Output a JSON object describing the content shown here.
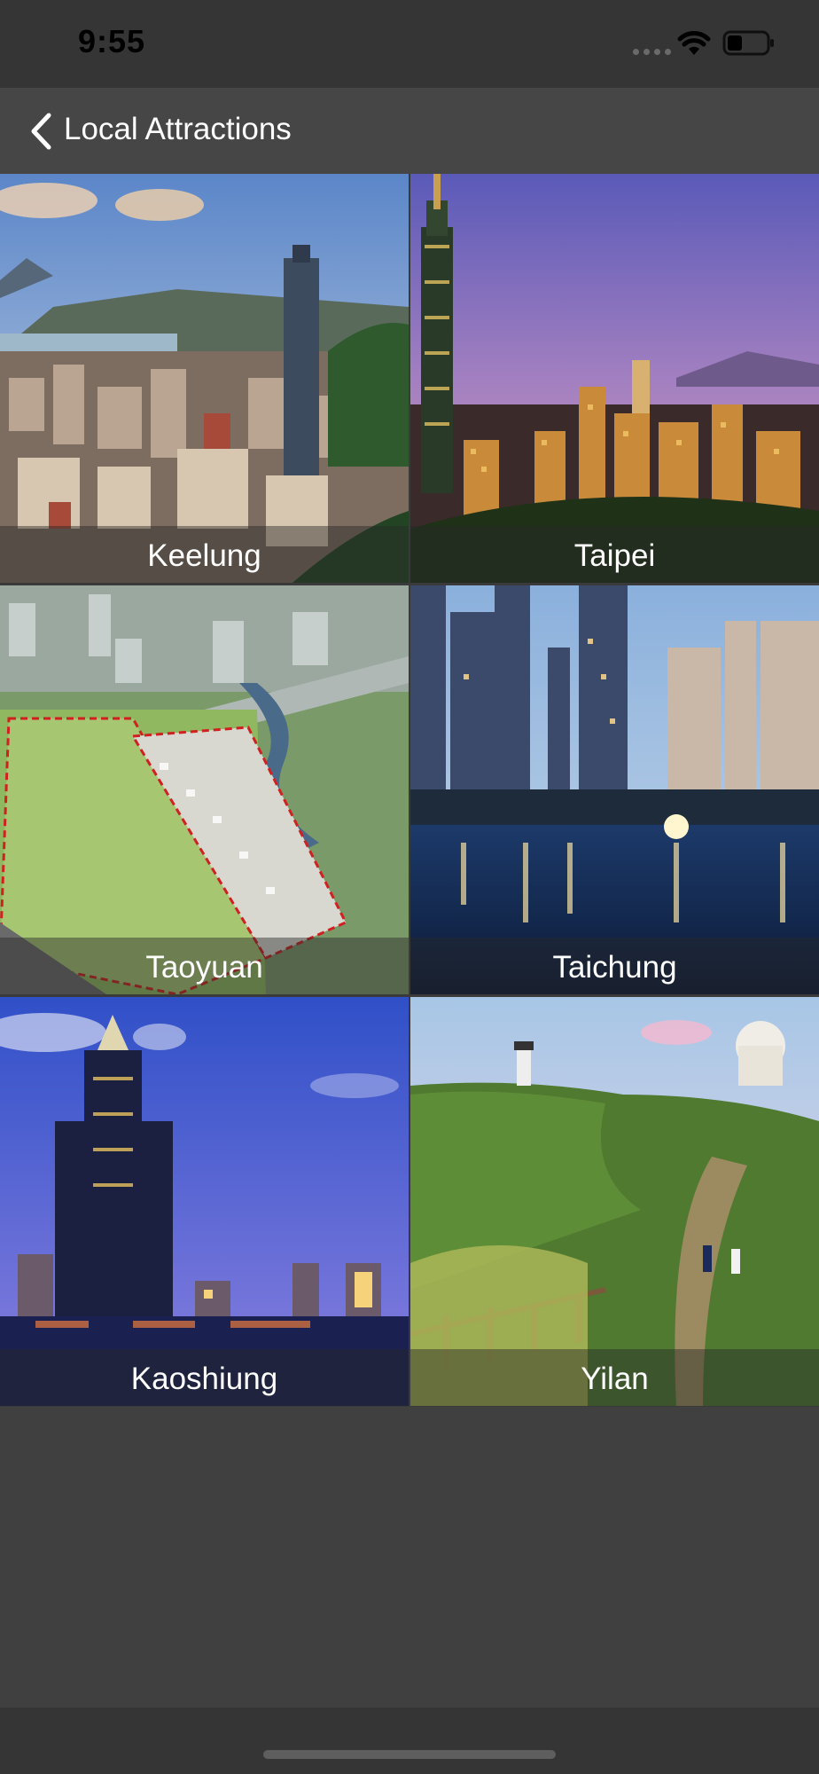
{
  "status_bar": {
    "time": "9:55",
    "icons": [
      "signal-icon",
      "wifi-icon",
      "battery-icon"
    ]
  },
  "nav": {
    "back_icon": "chevron-left-icon",
    "title": "Local Attractions"
  },
  "attractions": [
    {
      "label": "Keelung"
    },
    {
      "label": "Taipei"
    },
    {
      "label": "Taoyuan"
    },
    {
      "label": "Taichung"
    },
    {
      "label": "Kaoshiung"
    },
    {
      "label": "Yilan"
    }
  ],
  "colors": {
    "status_bar_bg": "#353535",
    "nav_bg": "#464646",
    "page_bg": "#404040",
    "text": "#ffffff"
  }
}
